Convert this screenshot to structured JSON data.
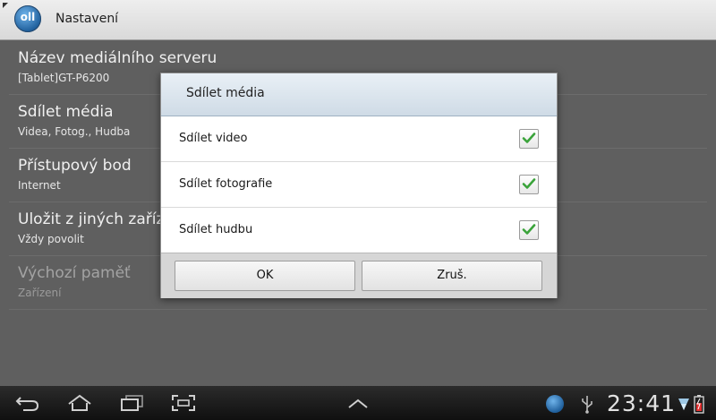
{
  "topbar": {
    "app_icon_text": "oll",
    "title": "Nastavení"
  },
  "settings": [
    {
      "title": "Název mediálního serveru",
      "subtitle": "[Tablet]GT-P6200",
      "enabled": true
    },
    {
      "title": "Sdílet média",
      "subtitle": "Videa, Fotog., Hudba",
      "enabled": true
    },
    {
      "title": "Přístupový bod",
      "subtitle": "Internet",
      "enabled": true
    },
    {
      "title": "Uložit z jiných zařízení",
      "subtitle": "Vždy povolit",
      "enabled": true
    },
    {
      "title": "Výchozí paměť",
      "subtitle": "Zařízení",
      "enabled": false
    }
  ],
  "dialog": {
    "title": "Sdílet média",
    "options": [
      {
        "label": "Sdílet video",
        "checked": true
      },
      {
        "label": "Sdílet fotografie",
        "checked": true
      },
      {
        "label": "Sdílet hudbu",
        "checked": true
      }
    ],
    "ok_label": "OK",
    "cancel_label": "Zruš."
  },
  "statusbar": {
    "time": "23:41",
    "icons": [
      "back-icon",
      "home-icon",
      "recent-apps-icon",
      "screenshot-icon",
      "up-arrow-icon",
      "allshare-icon",
      "usb-icon",
      "wifi-icon",
      "battery-icon"
    ]
  },
  "colors": {
    "accent_check": "#3aa33a",
    "dialog_header": "#dce6ef",
    "dim_background": "#5f5f5f"
  }
}
